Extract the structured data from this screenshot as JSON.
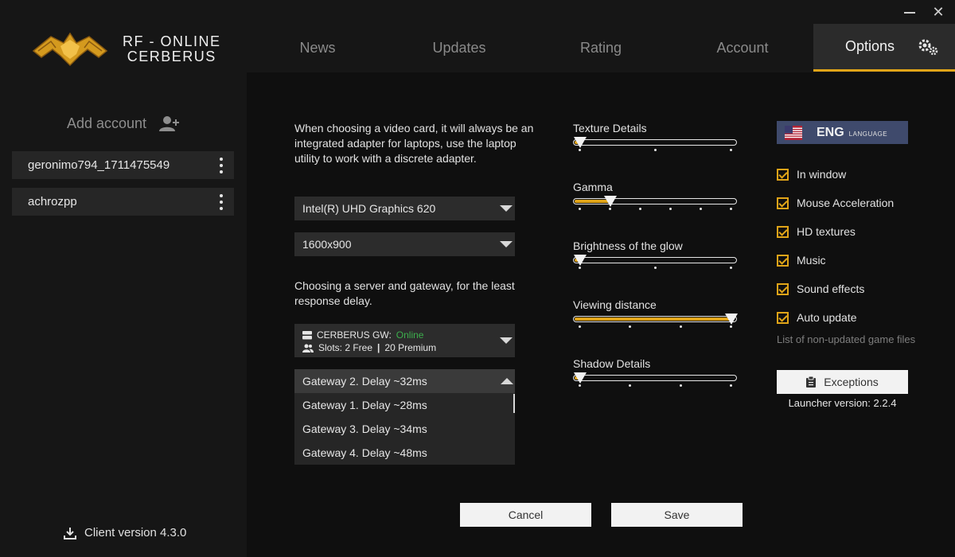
{
  "app": {
    "logo_line1": "RF - ONLINE",
    "logo_line2": "CERBERUS",
    "minimize_icon": "minimize-icon",
    "close_glyph": "✕"
  },
  "sidebar": {
    "add_account_label": "Add account",
    "accounts": [
      {
        "name": "geronimo794_1711475549"
      },
      {
        "name": "achrozpp"
      }
    ],
    "client_version": "Client version 4.3.0"
  },
  "nav": {
    "tabs": [
      {
        "label": "News"
      },
      {
        "label": "Updates"
      },
      {
        "label": "Rating"
      },
      {
        "label": "Account"
      },
      {
        "label": "Options",
        "active": true
      }
    ]
  },
  "options": {
    "video_hint": "When choosing a video card, it will always be an integrated adapter for laptops, use the laptop utility to work with a discrete adapter.",
    "video_card": "Intel(R) UHD Graphics 620",
    "resolution": "1600x900",
    "server_hint": "Choosing a server and gateway, for the least response delay.",
    "server": {
      "name": "CERBERUS GW:",
      "status": "Online",
      "slots_prefix": "Slots: 2 Free",
      "slots_sep": "|",
      "slots_premium": "20 Premium"
    },
    "gateways": [
      "Gateway 2. Delay ~32ms",
      "Gateway 1. Delay ~28ms",
      "Gateway 3. Delay ~34ms",
      "Gateway 4. Delay ~48ms"
    ],
    "sliders": [
      {
        "label": "Texture Details",
        "steps": 3,
        "value_index": 0
      },
      {
        "label": "Gamma",
        "steps": 6,
        "value_index": 1
      },
      {
        "label": "Brightness of the glow",
        "steps": 3,
        "value_index": 0
      },
      {
        "label": "Viewing distance",
        "steps": 4,
        "value_index": 3
      },
      {
        "label": "Shadow Details",
        "steps": 4,
        "value_index": 0
      }
    ],
    "language": {
      "code": "ENG",
      "label": "LANGUAGE"
    },
    "checkboxes": [
      {
        "label": "In window",
        "checked": true
      },
      {
        "label": "Mouse Acceleration",
        "checked": true
      },
      {
        "label": "HD textures",
        "checked": true
      },
      {
        "label": "Music",
        "checked": true
      },
      {
        "label": "Sound effects",
        "checked": true
      },
      {
        "label": "Auto update",
        "checked": true
      }
    ],
    "non_updated_note": "List of non-updated game files",
    "exceptions_label": "Exceptions",
    "launcher_version": "Launcher version: 2.2.4",
    "cancel_label": "Cancel",
    "save_label": "Save"
  },
  "colors": {
    "accent": "#e0a418",
    "online": "#3cae4c",
    "lang_bg": "#3f4a6c"
  }
}
